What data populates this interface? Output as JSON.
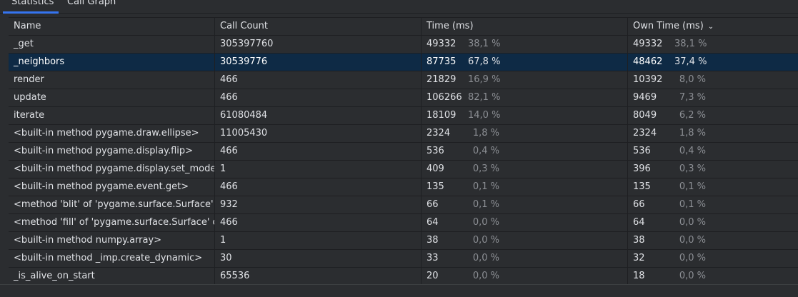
{
  "tabs": [
    {
      "label": "Statistics"
    },
    {
      "label": "Call Graph"
    }
  ],
  "columns": {
    "name": "Name",
    "call_count": "Call Count",
    "time": "Time (ms)",
    "own_time": "Own Time (ms)",
    "sort_icon": "chevron-down-icon"
  },
  "colors": {
    "selected_row": "#0e2a45",
    "active_tab_underline": "#3574f0"
  },
  "rows": [
    {
      "name": "_get",
      "count": "305397760",
      "time": "49332",
      "time_pct": "38,1 %",
      "own": "49332",
      "own_pct": "38,1 %",
      "selected": false
    },
    {
      "name": "_neighbors",
      "count": "30539776",
      "time": "87735",
      "time_pct": "67,8 %",
      "own": "48462",
      "own_pct": "37,4 %",
      "selected": true
    },
    {
      "name": "render",
      "count": "466",
      "time": "21829",
      "time_pct": "16,9 %",
      "own": "10392",
      "own_pct": "8,0 %",
      "selected": false
    },
    {
      "name": "update",
      "count": "466",
      "time": "106266",
      "time_pct": "82,1 %",
      "own": "9469",
      "own_pct": "7,3 %",
      "selected": false
    },
    {
      "name": "iterate",
      "count": "61080484",
      "time": "18109",
      "time_pct": "14,0 %",
      "own": "8049",
      "own_pct": "6,2 %",
      "selected": false
    },
    {
      "name": "<built-in method pygame.draw.ellipse>",
      "count": "11005430",
      "time": "2324",
      "time_pct": "1,8 %",
      "own": "2324",
      "own_pct": "1,8 %",
      "selected": false
    },
    {
      "name": "<built-in method pygame.display.flip>",
      "count": "466",
      "time": "536",
      "time_pct": "0,4 %",
      "own": "536",
      "own_pct": "0,4 %",
      "selected": false
    },
    {
      "name": "<built-in method pygame.display.set_mode>",
      "count": "1",
      "time": "409",
      "time_pct": "0,3 %",
      "own": "396",
      "own_pct": "0,3 %",
      "selected": false
    },
    {
      "name": "<built-in method pygame.event.get>",
      "count": "466",
      "time": "135",
      "time_pct": "0,1 %",
      "own": "135",
      "own_pct": "0,1 %",
      "selected": false
    },
    {
      "name": "<method 'blit' of 'pygame.surface.Surface' obj",
      "count": "932",
      "time": "66",
      "time_pct": "0,1 %",
      "own": "66",
      "own_pct": "0,1 %",
      "selected": false
    },
    {
      "name": "<method 'fill' of 'pygame.surface.Surface' obje",
      "count": "466",
      "time": "64",
      "time_pct": "0,0 %",
      "own": "64",
      "own_pct": "0,0 %",
      "selected": false
    },
    {
      "name": "<built-in method numpy.array>",
      "count": "1",
      "time": "38",
      "time_pct": "0,0 %",
      "own": "38",
      "own_pct": "0,0 %",
      "selected": false
    },
    {
      "name": "<built-in method _imp.create_dynamic>",
      "count": "30",
      "time": "33",
      "time_pct": "0,0 %",
      "own": "32",
      "own_pct": "0,0 %",
      "selected": false
    },
    {
      "name": "_is_alive_on_start",
      "count": "65536",
      "time": "20",
      "time_pct": "0,0 %",
      "own": "18",
      "own_pct": "0,0 %",
      "selected": false
    }
  ]
}
